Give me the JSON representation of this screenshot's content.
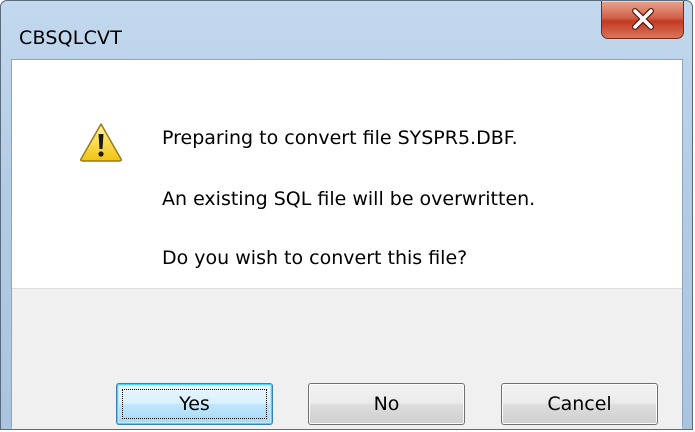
{
  "window": {
    "title": "CBSQLCVT"
  },
  "titlebar": {
    "close_icon": "close-x-icon"
  },
  "content": {
    "icon": "warning-triangle-icon",
    "line1": "Preparing to convert file SYSPR5.DBF.",
    "line2": "An existing SQL file will be overwritten.",
    "line3": "Do you wish to convert this file?"
  },
  "buttons": {
    "yes": "Yes",
    "no": "No",
    "cancel": "Cancel"
  },
  "colors": {
    "close_button": "#c23a22",
    "frame": "#b4cde6",
    "default_button_border": "#3c7fb1",
    "warning_fill": "#f5d21e"
  }
}
